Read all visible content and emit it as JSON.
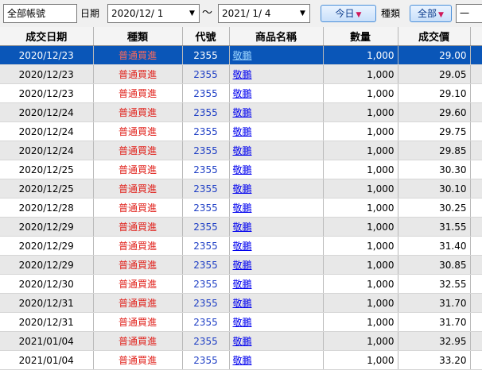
{
  "toolbar": {
    "account": "全部帳號",
    "date_label": "日期",
    "date_from": "2020/12/ 1",
    "range_sep": "～",
    "date_to": "2021/ 1/ 4",
    "today_button": "今日",
    "type_label": "種類",
    "type_select": "全部",
    "extra_field": "一"
  },
  "table": {
    "columns": [
      "成交日期",
      "種類",
      "代號",
      "商品名稱",
      "數量",
      "成交價"
    ],
    "rows": [
      {
        "date": "2020/12/23",
        "type": "普通買進",
        "code": "2355",
        "name": "敬鵬",
        "qty": "1,000",
        "price": "29.00"
      },
      {
        "date": "2020/12/23",
        "type": "普通買進",
        "code": "2355",
        "name": "敬鵬",
        "qty": "1,000",
        "price": "29.05"
      },
      {
        "date": "2020/12/23",
        "type": "普通買進",
        "code": "2355",
        "name": "敬鵬",
        "qty": "1,000",
        "price": "29.10"
      },
      {
        "date": "2020/12/24",
        "type": "普通買進",
        "code": "2355",
        "name": "敬鵬",
        "qty": "1,000",
        "price": "29.60"
      },
      {
        "date": "2020/12/24",
        "type": "普通買進",
        "code": "2355",
        "name": "敬鵬",
        "qty": "1,000",
        "price": "29.75"
      },
      {
        "date": "2020/12/24",
        "type": "普通買進",
        "code": "2355",
        "name": "敬鵬",
        "qty": "1,000",
        "price": "29.85"
      },
      {
        "date": "2020/12/25",
        "type": "普通買進",
        "code": "2355",
        "name": "敬鵬",
        "qty": "1,000",
        "price": "30.30"
      },
      {
        "date": "2020/12/25",
        "type": "普通買進",
        "code": "2355",
        "name": "敬鵬",
        "qty": "1,000",
        "price": "30.10"
      },
      {
        "date": "2020/12/28",
        "type": "普通買進",
        "code": "2355",
        "name": "敬鵬",
        "qty": "1,000",
        "price": "30.25"
      },
      {
        "date": "2020/12/29",
        "type": "普通買進",
        "code": "2355",
        "name": "敬鵬",
        "qty": "1,000",
        "price": "31.55"
      },
      {
        "date": "2020/12/29",
        "type": "普通買進",
        "code": "2355",
        "name": "敬鵬",
        "qty": "1,000",
        "price": "31.40"
      },
      {
        "date": "2020/12/29",
        "type": "普通買進",
        "code": "2355",
        "name": "敬鵬",
        "qty": "1,000",
        "price": "30.85"
      },
      {
        "date": "2020/12/30",
        "type": "普通買進",
        "code": "2355",
        "name": "敬鵬",
        "qty": "1,000",
        "price": "32.55"
      },
      {
        "date": "2020/12/31",
        "type": "普通買進",
        "code": "2355",
        "name": "敬鵬",
        "qty": "1,000",
        "price": "31.70"
      },
      {
        "date": "2020/12/31",
        "type": "普通買進",
        "code": "2355",
        "name": "敬鵬",
        "qty": "1,000",
        "price": "31.70"
      },
      {
        "date": "2021/01/04",
        "type": "普通買進",
        "code": "2355",
        "name": "敬鵬",
        "qty": "1,000",
        "price": "32.95"
      },
      {
        "date": "2021/01/04",
        "type": "普通買進",
        "code": "2355",
        "name": "敬鵬",
        "qty": "1,000",
        "price": "33.20"
      }
    ],
    "selected_row": 0
  },
  "colors": {
    "selection": "#0a56b8",
    "type_text": "#e0201a",
    "code_text": "#1f3fc5",
    "link_text": "#0000ee",
    "alt_row": "#e8e8e8"
  }
}
